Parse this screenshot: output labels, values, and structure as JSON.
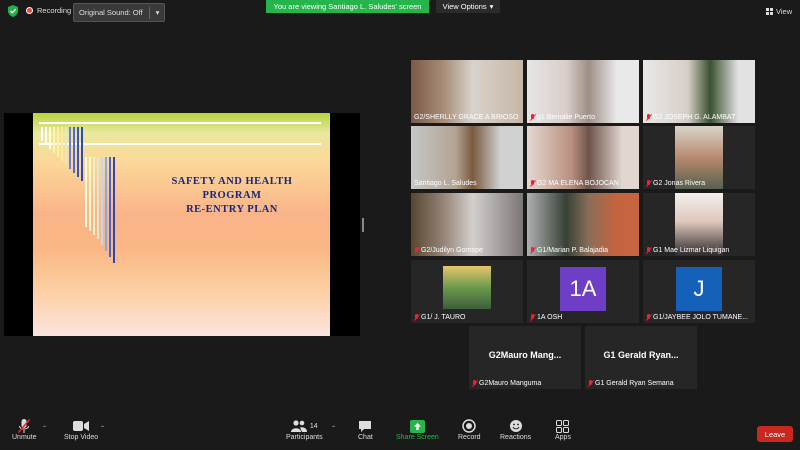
{
  "top": {
    "recording_label": "Recording",
    "original_sound_label": "Original Sound: Off",
    "viewing_banner": "You are viewing Santiago L. Saludes' screen",
    "view_options_label": "View Options",
    "view_label": "View"
  },
  "slide": {
    "title_line1": "SAFETY AND HEALTH",
    "title_line2": "PROGRAM",
    "title_line3": "RE-ENTRY PLAN"
  },
  "participants": [
    {
      "name": "G2/SHERLLY GRACE A BRIOSO",
      "muted": false
    },
    {
      "name": "g1 Bernalie Puerto",
      "muted": true
    },
    {
      "name": "G2 JOSEPH G. ALAMBAT",
      "muted": true
    },
    {
      "name": "Santiago L. Saludes",
      "muted": false
    },
    {
      "name": "G2 MA ELENA BOJOCAN",
      "muted": true
    },
    {
      "name": "G2 Jonas Rivera",
      "muted": true
    },
    {
      "name": "G2/Judilyn Gorospe",
      "muted": true
    },
    {
      "name": "G1/Marian P. Balajadia",
      "muted": true
    },
    {
      "name": "G1 Mae Lizmar Liquigan",
      "muted": true
    },
    {
      "name": "G1/ J. TAURO",
      "muted": true
    },
    {
      "name": "1A OSH",
      "muted": true,
      "initials": "1A",
      "color": "#6f3ec6"
    },
    {
      "name": "G1/JAYBEE JOLO TUMANE...",
      "muted": true,
      "initials": "J",
      "color": "#1560b8"
    },
    {
      "name": "G2Mauro Manguma",
      "muted": true,
      "display": "G2Mauro  Mang..."
    },
    {
      "name": "G1 Gerald Ryan Semana",
      "muted": true,
      "display": "G1 Gerald Ryan..."
    }
  ],
  "toolbar": {
    "unmute": "Unmute",
    "stop_video": "Stop Video",
    "participants": "Participants",
    "participants_count": "14",
    "chat": "Chat",
    "share_screen": "Share Screen",
    "record": "Record",
    "reactions": "Reactions",
    "apps": "Apps",
    "leave": "Leave"
  },
  "colors": {
    "share_green": "#25b54a",
    "leave_red": "#c8281d",
    "active_speaker": "#c6d43a"
  }
}
